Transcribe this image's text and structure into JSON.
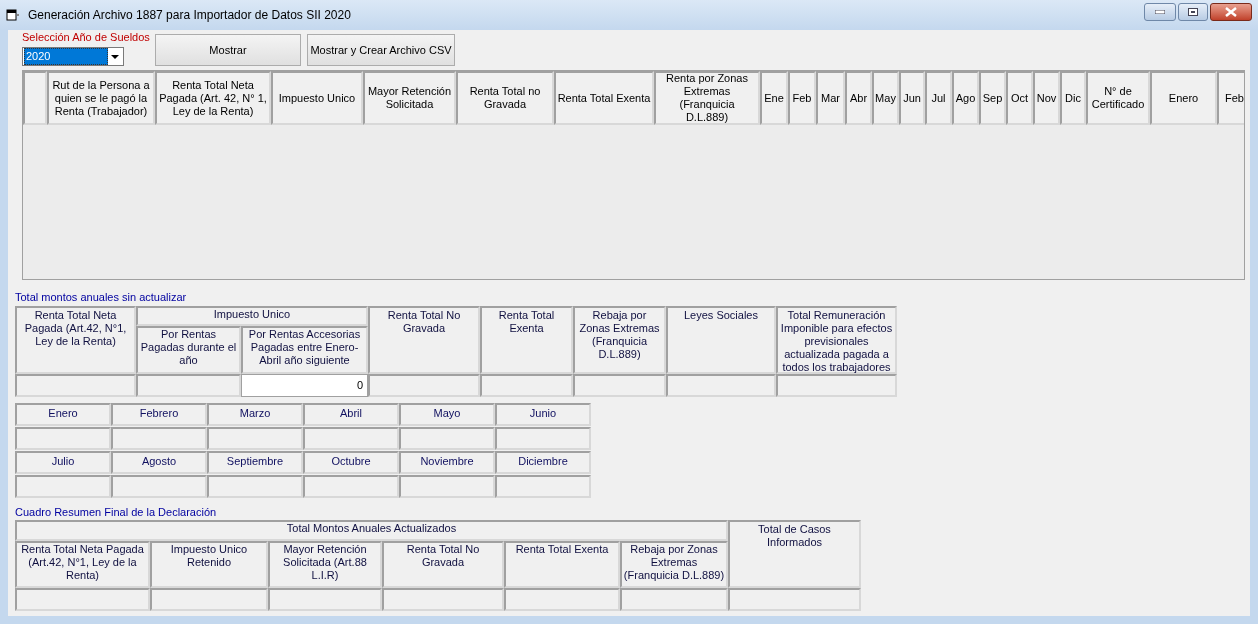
{
  "window": {
    "title": "Generación Archivo 1887 para Importador de Datos SII 2020"
  },
  "year_selector": {
    "label": "Selección Año de Sueldos",
    "value": "2020"
  },
  "buttons": [
    "Mostrar",
    "Mostrar y Crear Archivo CSV"
  ],
  "grid": {
    "columns": [
      "Rut de la Persona a quien se le pagó la Renta (Trabajador)",
      "Renta Total Neta Pagada (Art. 42, N° 1, Ley de la Renta)",
      "Impuesto Unico",
      "Mayor Retención Solicitada",
      "Renta Total no Gravada",
      "Renta Total Exenta",
      "Renta por Zonas Extremas (Franquicia D.L.889)",
      "Ene",
      "Feb",
      "Mar",
      "Abr",
      "May",
      "Jun",
      "Jul",
      "Ago",
      "Sep",
      "Oct",
      "Nov",
      "Dic",
      "N° de Certificado",
      "Enero",
      "Feb"
    ]
  },
  "annual_totals": {
    "title": "Total montos anuales sin actualizar",
    "columns": [
      {
        "label": "Renta Total Neta Pagada (Art.42, N°1, Ley de la Renta)"
      },
      {
        "label": "Impuesto Unico",
        "children": [
          {
            "label": "Por Rentas Pagadas durante el año"
          },
          {
            "label": "Por Rentas Accesorias Pagadas entre Enero-Abril año siguiente",
            "value": "0"
          }
        ]
      },
      {
        "label": "Renta Total No Gravada"
      },
      {
        "label": "Renta Total Exenta"
      },
      {
        "label": "Rebaja por Zonas Extremas (Franquicia D.L.889)"
      },
      {
        "label": "Leyes Sociales"
      },
      {
        "label": "Total Remuneración Imponible para efectos previsionales actualizada pagada a todos los trabajadores"
      }
    ]
  },
  "months": [
    "Enero",
    "Febrero",
    "Marzo",
    "Abril",
    "Mayo",
    "Junio",
    "Julio",
    "Agosto",
    "Septiembre",
    "Octubre",
    "Noviembre",
    "Diciembre"
  ],
  "summary": {
    "title": "Cuadro Resumen Final de la Declaración",
    "group_label": "Total Montos Anuales Actualizados",
    "columns": [
      "Renta Total Neta Pagada (Art.42, N°1, Ley de la Renta)",
      "Impuesto Unico Retenido",
      "Mayor Retención Solicitada (Art.88 L.I.R)",
      "Renta Total No Gravada",
      "Renta Total Exenta",
      "Rebaja por Zonas Extremas (Franquicia D.L.889)"
    ],
    "extra_column": "Total de Casos Informados"
  }
}
